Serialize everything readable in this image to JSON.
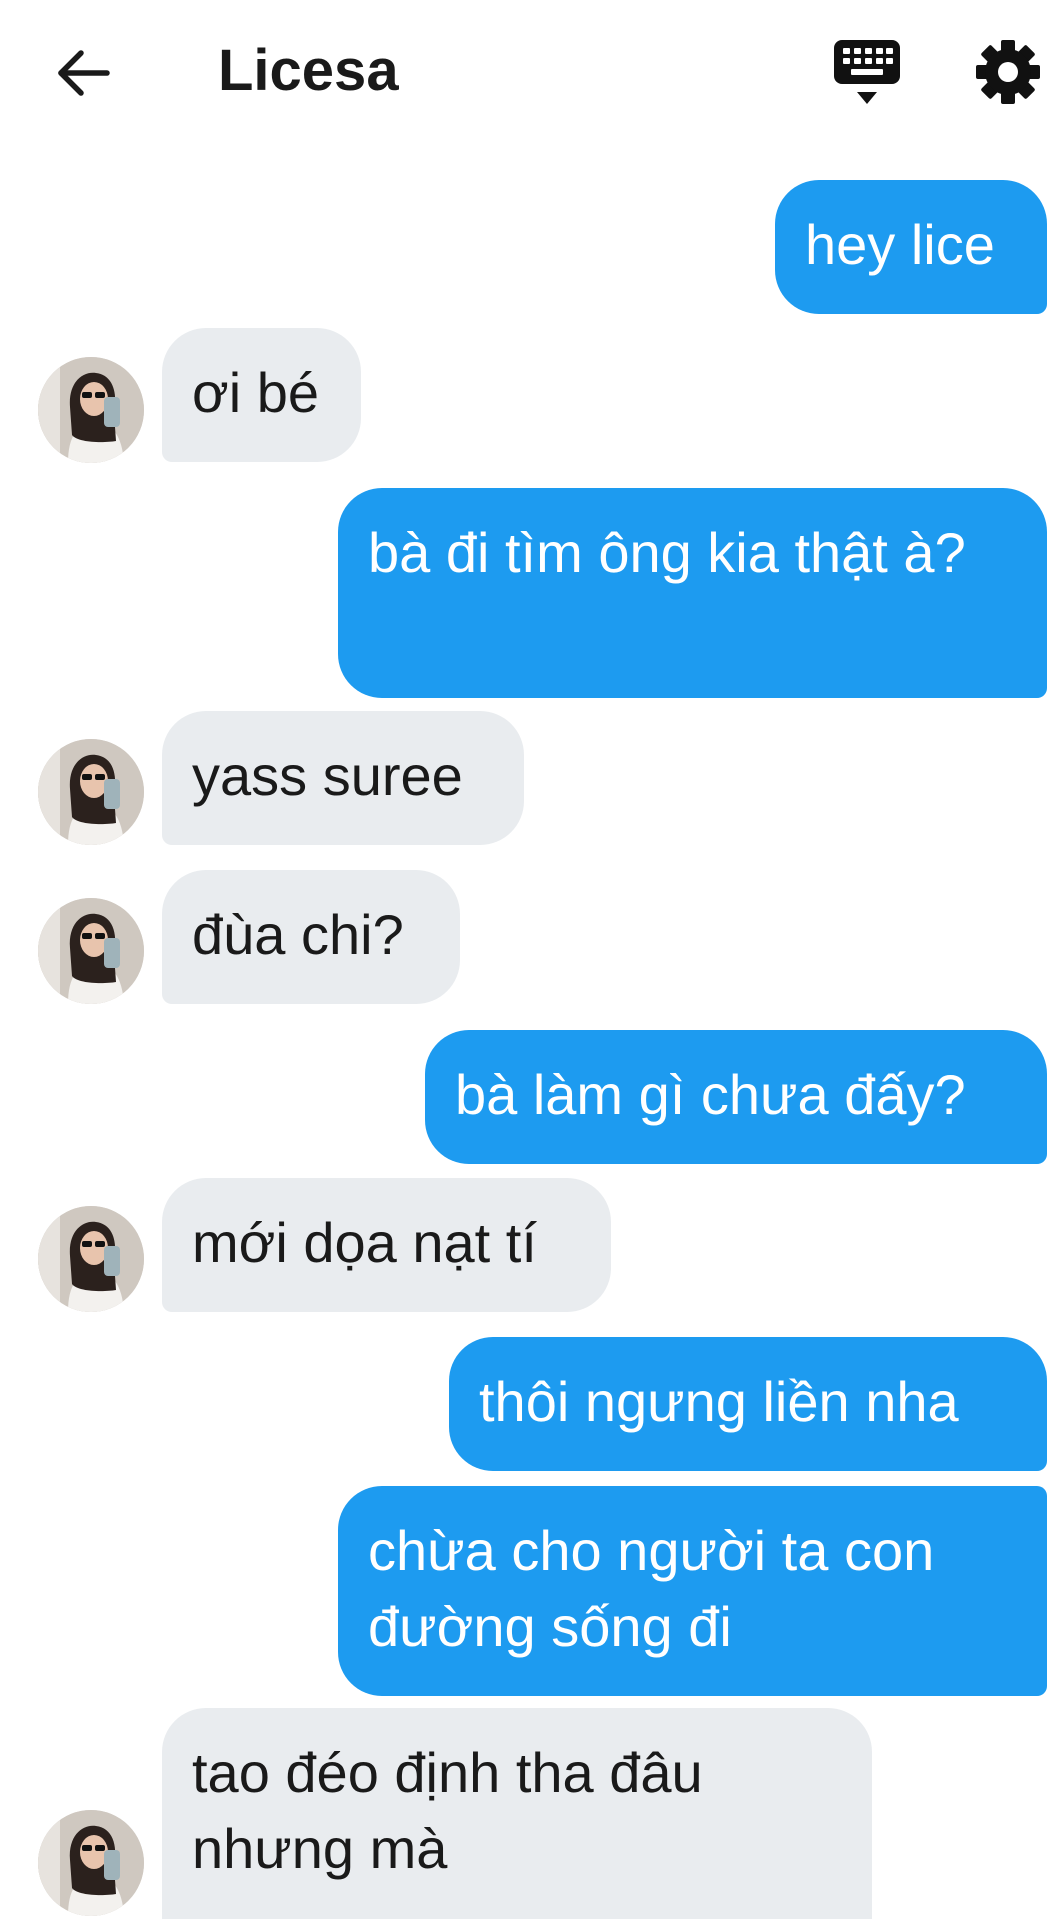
{
  "header": {
    "title": "Licesa",
    "back_icon": "arrow-left-icon",
    "keyboard_icon": "keyboard-icon",
    "settings_icon": "gear-icon"
  },
  "colors": {
    "outgoing_bubble": "#1d9bf0",
    "incoming_bubble": "#e9ecef",
    "text_dark": "#1a1a1a"
  },
  "messages": [
    {
      "side": "out",
      "text": "hey lice"
    },
    {
      "side": "in",
      "text": "ơi bé",
      "avatar": true
    },
    {
      "side": "out",
      "text": "bà đi tìm ông kia thật à?"
    },
    {
      "side": "in",
      "text": "yass suree",
      "avatar": true
    },
    {
      "side": "in",
      "text": "đùa chi?",
      "avatar": true
    },
    {
      "side": "out",
      "text": "bà làm gì chưa đấy?"
    },
    {
      "side": "in",
      "text": "mới dọa nạt tí",
      "avatar": true
    },
    {
      "side": "out",
      "text": "thôi ngưng liền nha"
    },
    {
      "side": "out",
      "text": "chừa cho người ta con đường sống đi"
    },
    {
      "side": "in",
      "text": "tao đéo định tha đâu nhưng mà",
      "avatar": true
    }
  ]
}
